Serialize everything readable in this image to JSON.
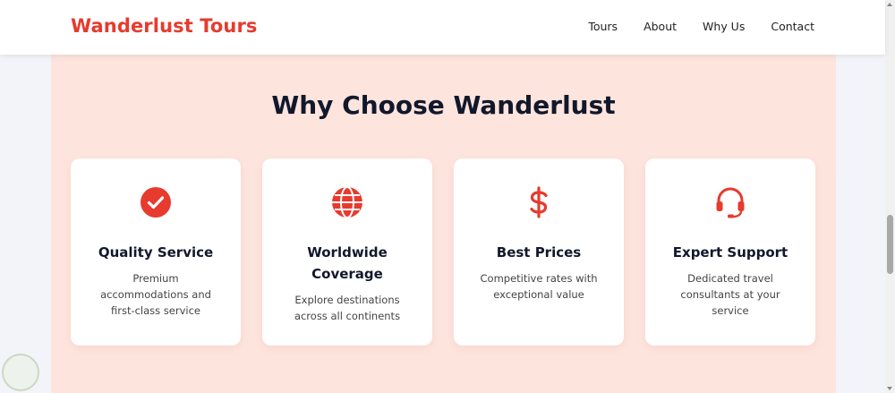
{
  "header": {
    "logo": "Wanderlust Tours",
    "nav": [
      "Tours",
      "About",
      "Why Us",
      "Contact"
    ]
  },
  "section": {
    "title": "Why Choose Wanderlust",
    "cards": [
      {
        "title": "Quality Service",
        "description": "Premium accommodations and first-class service",
        "icon": "check-circle-icon"
      },
      {
        "title": "Worldwide Coverage",
        "description": "Explore destinations across all continents",
        "icon": "globe-icon"
      },
      {
        "title": "Best Prices",
        "description": "Competitive rates with exceptional value",
        "icon": "dollar-icon"
      },
      {
        "title": "Expert Support",
        "description": "Dedicated travel consultants at your service",
        "icon": "headset-icon"
      }
    ]
  },
  "colors": {
    "brand": "#e63b2e",
    "section_bg": "#fde5de",
    "heading": "#12182b"
  }
}
